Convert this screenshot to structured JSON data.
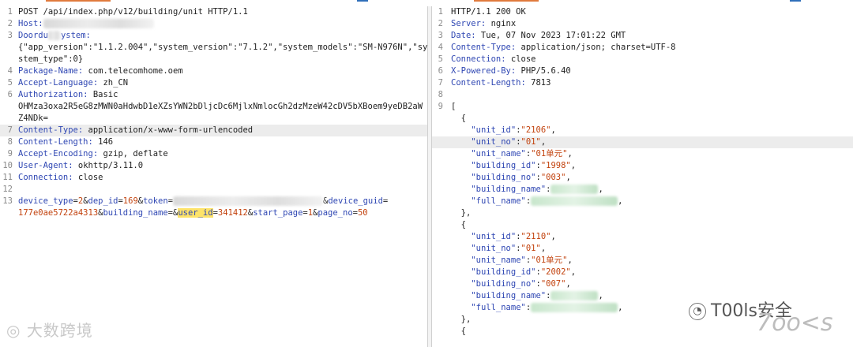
{
  "request": {
    "lines": [
      {
        "n": "1",
        "text": "POST /api/index.php/v12/building/unit HTTP/1.1"
      },
      {
        "n": "2",
        "key": "Host:",
        "value": ""
      },
      {
        "n": "3",
        "key": "Doordu",
        "key2": "ystem:"
      },
      {
        "n": "",
        "text": "{\"app_version\":\"1.1.2.004\",\"system_version\":\"7.1.2\",\"system_models\":\"SM-N976N\",\"sy"
      },
      {
        "n": "",
        "text": "stem_type\":0}"
      },
      {
        "n": "4",
        "key": "Package-Name:",
        "value": " com.telecomhome.oem"
      },
      {
        "n": "5",
        "key": "Accept-Language:",
        "value": " zh_CN"
      },
      {
        "n": "6",
        "key": "Authorization:",
        "value": " Basic"
      },
      {
        "n": "",
        "text": "OHMza3oxa2R5eG8zMWN0aHdwbD1eXZsYWN2bDljcDc6MjlxNmlocGh2dzMzeW42cDV5bXBoem9yeDB2aW"
      },
      {
        "n": "",
        "text": "Z4NDk="
      },
      {
        "n": "7",
        "key": "Content-Type:",
        "value": " application/x-www-form-urlencoded"
      },
      {
        "n": "8",
        "key": "Content-Length:",
        "value": " 146"
      },
      {
        "n": "9",
        "key": "Accept-Encoding:",
        "value": " gzip, deflate"
      },
      {
        "n": "10",
        "key": "User-Agent:",
        "value": " okhttp/3.11.0"
      },
      {
        "n": "11",
        "key": "Connection:",
        "value": " close"
      },
      {
        "n": "12",
        "text": ""
      },
      {
        "n": "13"
      },
      {
        "n": ""
      }
    ],
    "body": {
      "device_type_name": "device_type",
      "device_type_value": "2",
      "dep_id_name": "dep_id",
      "dep_id_value": "169",
      "token_name": "token",
      "device_guid_name": "device_guid",
      "device_guid_value": "177e0ae5722a4313",
      "building_name_name": "building_name",
      "user_id_name": "user_id",
      "user_id_value": "341412",
      "start_page_name": "start_page",
      "start_page_value": "1",
      "page_no_name": "page_no",
      "page_no_value": "50"
    }
  },
  "response": {
    "headers": [
      {
        "n": "1",
        "text": "HTTP/1.1 200 OK"
      },
      {
        "n": "2",
        "key": "Server:",
        "value": " nginx"
      },
      {
        "n": "3",
        "key": "Date:",
        "value": " Tue, 07 Nov 2023 17:01:22 GMT"
      },
      {
        "n": "4",
        "key": "Content-Type:",
        "value": " application/json; charset=UTF-8"
      },
      {
        "n": "5",
        "key": "Connection:",
        "value": " close"
      },
      {
        "n": "6",
        "key": "X-Powered-By:",
        "value": " PHP/5.6.40"
      },
      {
        "n": "7",
        "key": "Content-Length:",
        "value": " 7813"
      },
      {
        "n": "8",
        "text": ""
      },
      {
        "n": "9",
        "text": "["
      }
    ],
    "items": [
      {
        "unit_id": "2106",
        "unit_no": "01",
        "unit_name": "01单元",
        "building_id": "1998",
        "building_no": "003"
      },
      {
        "unit_id": "2110",
        "unit_no": "01",
        "unit_name": "01单元",
        "building_id": "2002",
        "building_no": "007"
      }
    ],
    "keys": {
      "unit_id": "\"unit_id\"",
      "unit_no": "\"unit_no\"",
      "unit_name": "\"unit_name\"",
      "building_id": "\"building_id\"",
      "building_no": "\"building_no\"",
      "building_name": "\"building_name\"",
      "full_name": "\"full_name\""
    }
  },
  "watermarks": {
    "left": "大数跨境",
    "right": "T00ls安全",
    "right_sub": "7oo<s"
  }
}
